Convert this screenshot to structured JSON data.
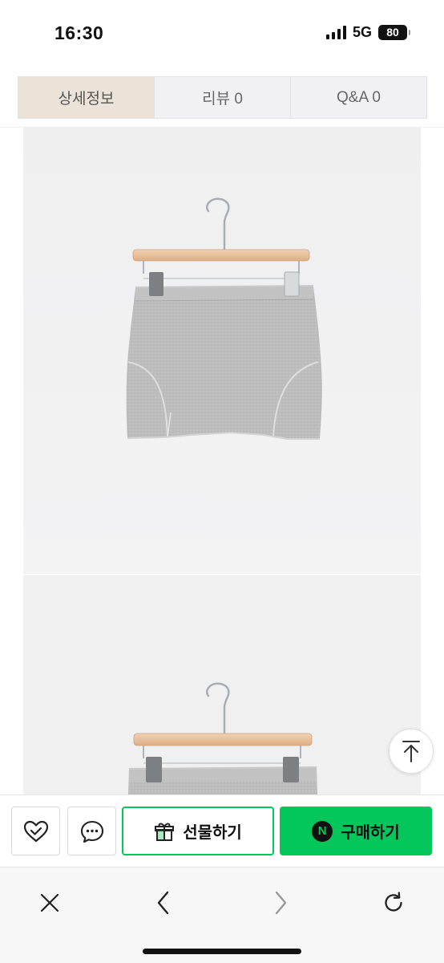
{
  "status_bar": {
    "time": "16:30",
    "network": "5G",
    "battery": "80"
  },
  "tabs": [
    {
      "label": "상세정보",
      "active": true
    },
    {
      "label": "리뷰  0",
      "active": false
    },
    {
      "label": "Q&A  0",
      "active": false
    }
  ],
  "product": {
    "images": [
      "gray-mini-skirt-on-hanger-front",
      "gray-mini-skirt-on-hanger-second"
    ]
  },
  "action_bar": {
    "wish_icon": "heart-check-icon",
    "chat_icon": "chat-bubble-icon",
    "gift_label": "선물하기",
    "gift_icon": "gift-box-icon",
    "buy_label": "구매하기",
    "buy_badge": "N",
    "accent_color": "#03c75a"
  },
  "browser_toolbar": {
    "close_icon": "close-icon",
    "back_icon": "chevron-left-icon",
    "forward_icon": "chevron-right-icon",
    "reload_icon": "reload-icon"
  }
}
